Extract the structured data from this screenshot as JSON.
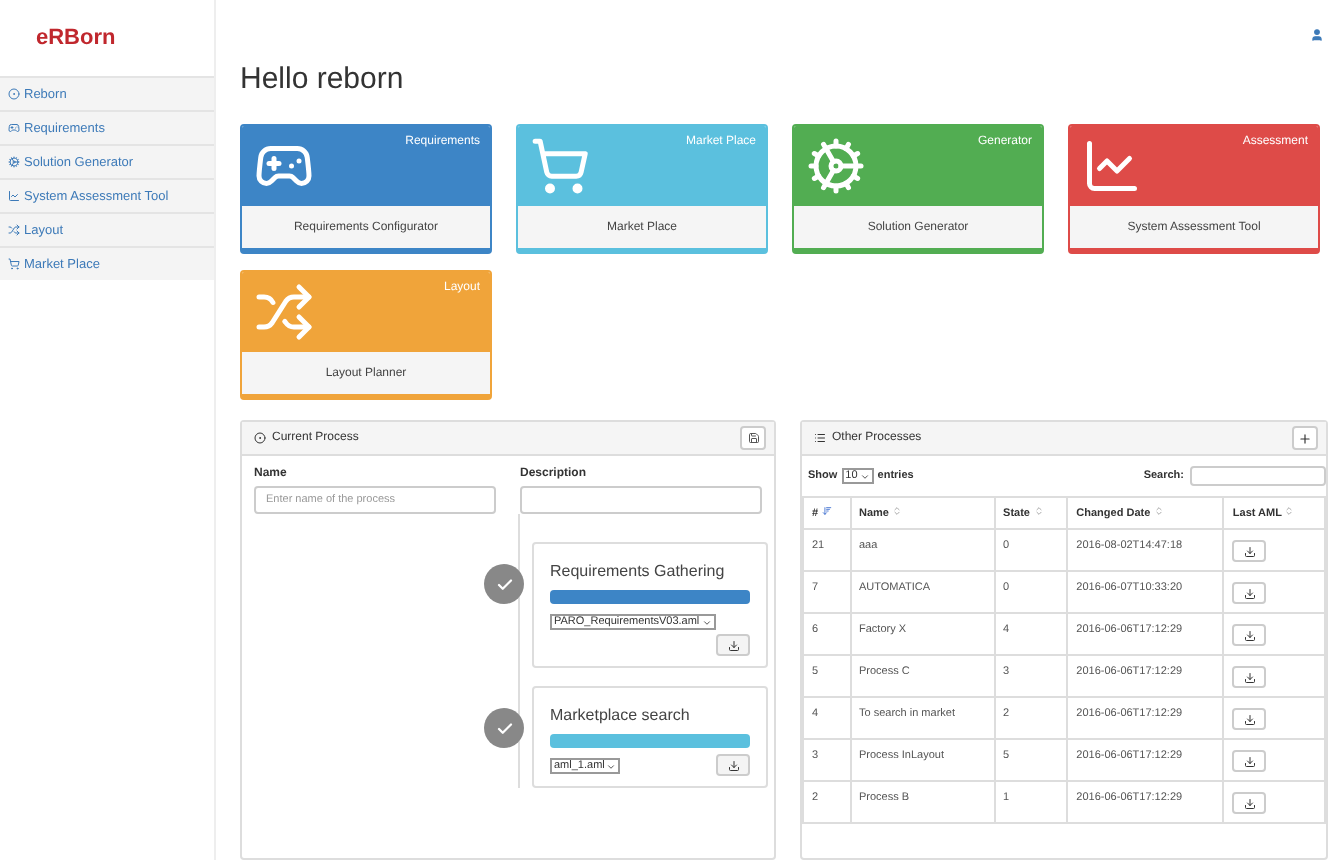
{
  "logo": "eRBorn",
  "sidebar": {
    "items": [
      {
        "label": "Reborn"
      },
      {
        "label": "Requirements"
      },
      {
        "label": "Solution Generator"
      },
      {
        "label": "System Assessment Tool"
      },
      {
        "label": "Layout"
      },
      {
        "label": "Market Place"
      }
    ]
  },
  "greeting": "Hello reborn",
  "tiles": [
    {
      "title": "Requirements",
      "label": "Requirements Configurator",
      "color": "#3d85c6"
    },
    {
      "title": "Market Place",
      "label": "Market Place",
      "color": "#5bc0de"
    },
    {
      "title": "Generator",
      "label": "Solution Generator",
      "color": "#52ad52"
    },
    {
      "title": "Assessment",
      "label": "System Assessment Tool",
      "color": "#de4b48"
    },
    {
      "title": "Layout",
      "label": "Layout Planner",
      "color": "#f0a43a"
    }
  ],
  "current_process": {
    "title": "Current Process",
    "name_label": "Name",
    "name_placeholder": "Enter name of the process",
    "description_label": "Description",
    "steps": [
      {
        "title": "Requirements Gathering",
        "color": "#3d85c6",
        "file": "PARO_RequirementsV03.aml"
      },
      {
        "title": "Marketplace search",
        "color": "#5bc0de",
        "file": "aml_1.aml"
      }
    ]
  },
  "other_processes": {
    "title": "Other Processes",
    "show_label": "Show",
    "page_size": "10",
    "entries_label": "entries",
    "search_label": "Search:",
    "columns": [
      {
        "label": "#",
        "sorted": true
      },
      {
        "label": "Name",
        "sorted": false
      },
      {
        "label": "State",
        "sorted": false
      },
      {
        "label": "Changed Date",
        "sorted": false
      },
      {
        "label": "Last AML",
        "sorted": false
      }
    ],
    "rows": [
      [
        "21",
        "aaa",
        "0",
        "2016-08-02T14:47:18"
      ],
      [
        "7",
        "AUTOMATICA",
        "0",
        "2016-06-07T10:33:20"
      ],
      [
        "6",
        "Factory X",
        "4",
        "2016-06-06T17:12:29"
      ],
      [
        "5",
        "Process C",
        "3",
        "2016-06-06T17:12:29"
      ],
      [
        "4",
        "To search in market",
        "2",
        "2016-06-06T17:12:29"
      ],
      [
        "3",
        "Process InLayout",
        "5",
        "2016-06-06T17:12:29"
      ],
      [
        "2",
        "Process B",
        "1",
        "2016-06-06T17:12:29"
      ]
    ]
  }
}
